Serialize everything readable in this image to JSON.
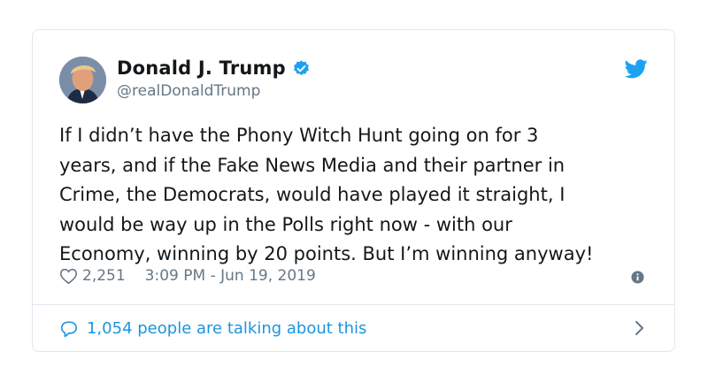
{
  "author": {
    "name": "Donald J. Trump",
    "handle": "@realDonaldTrump",
    "verified": true
  },
  "tweet": {
    "text": "If I didn’t have the Phony Witch Hunt going on for 3\nyears, and if the Fake News Media and their partner in\nCrime, the Democrats, would have played it straight, I\nwould be way up in the Polls right now - with our\nEconomy, winning by 20 points. But I’m winning anyway!",
    "likes": "2,251",
    "timestamp": "3:09 PM - Jun 19, 2019"
  },
  "footer": {
    "talking_label": "1,054 people are talking about this"
  },
  "colors": {
    "accent": "#1da1f2",
    "link": "#1b95e0",
    "muted": "#657786",
    "border": "#e1e8ed"
  },
  "icons": [
    "verified-badge-icon",
    "twitter-bird-icon",
    "heart-icon",
    "info-icon",
    "comment-bubble-icon",
    "chevron-right-icon"
  ]
}
